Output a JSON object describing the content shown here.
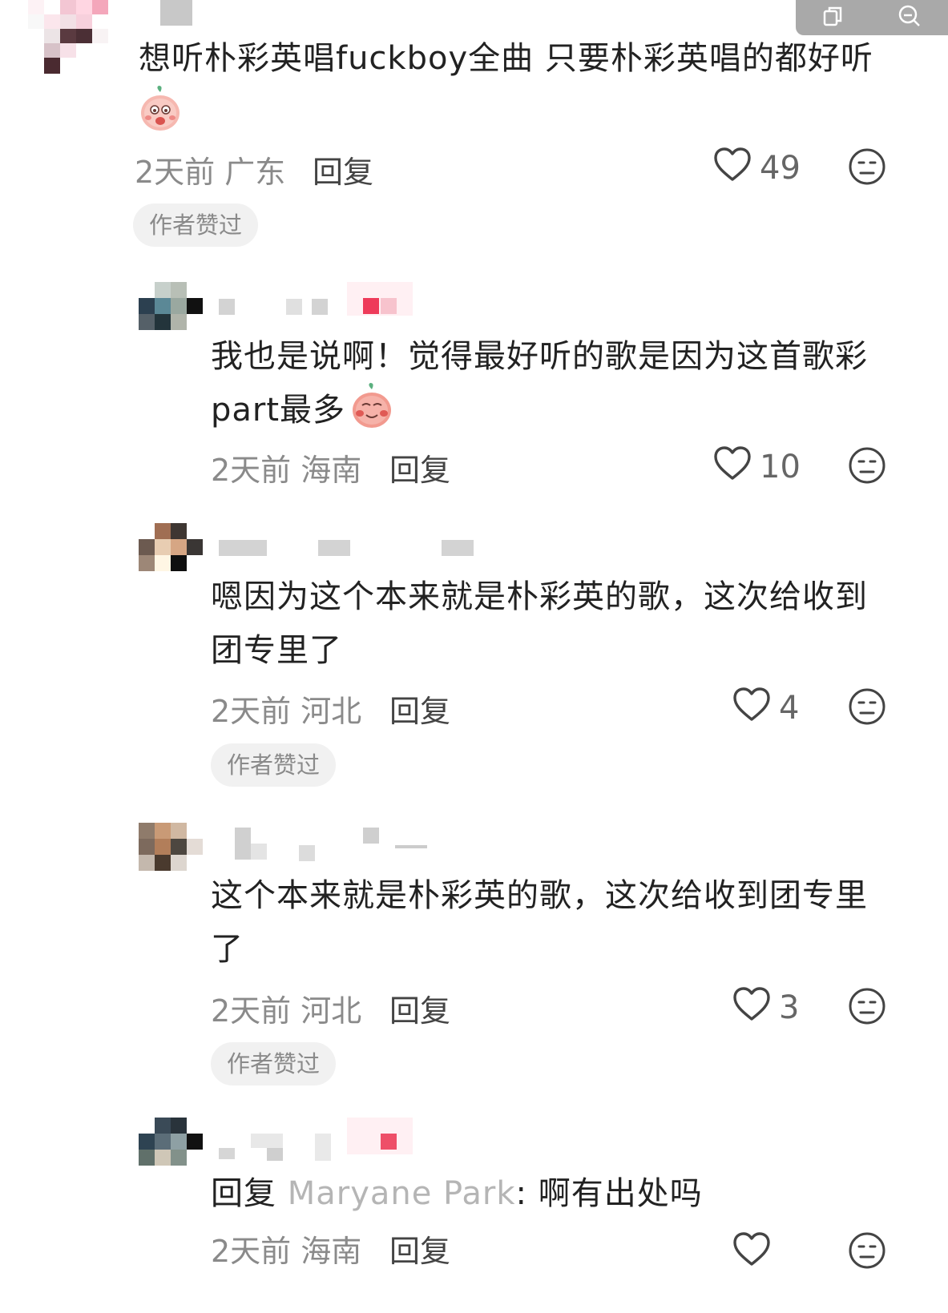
{
  "toolbar": {
    "copy_icon": "copy-icon",
    "search_icon": "search-icon"
  },
  "comments": [
    {
      "text": "想听朴彩英唱fuckboy全曲 只要朴彩英唱的都好听",
      "time": "2天前",
      "location": "广东",
      "reply_label": "回复",
      "likes": "49",
      "badge": "作者赞过"
    },
    {
      "text": "我也是说啊！觉得最好听的歌是因为这首歌彩part最多",
      "time": "2天前",
      "location": "海南",
      "reply_label": "回复",
      "likes": "10"
    },
    {
      "text": "嗯因为这个本来就是朴彩英的歌，这次给收到团专里了",
      "time": "2天前",
      "location": "河北",
      "reply_label": "回复",
      "likes": "4",
      "badge": "作者赞过"
    },
    {
      "text": "这个本来就是朴彩英的歌，这次给收到团专里了",
      "time": "2天前",
      "location": "河北",
      "reply_label": "回复",
      "likes": "3",
      "badge": "作者赞过"
    },
    {
      "reply_prefix": "回复",
      "reply_to": "Maryane Park",
      "reply_colon": ":",
      "text": "啊有出处吗",
      "time": "2天前",
      "location": "海南",
      "reply_label": "回复"
    }
  ]
}
